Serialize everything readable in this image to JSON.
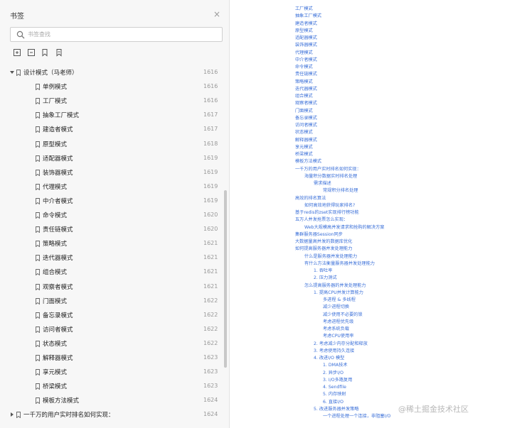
{
  "panel": {
    "title": "书签",
    "close_label": "×",
    "search_placeholder": "书签查找"
  },
  "toolbar": {
    "tools": [
      "expand-all-icon",
      "collapse-all-icon",
      "add-bookmark-icon",
      "remove-bookmark-icon"
    ]
  },
  "bookmarks": [
    {
      "label": "设计模式（马老师）",
      "page": "1616",
      "level": 0,
      "expanded": true
    },
    {
      "label": "单例模式",
      "page": "1616",
      "level": 1
    },
    {
      "label": "工厂模式",
      "page": "1616",
      "level": 1
    },
    {
      "label": "抽象工厂模式",
      "page": "1617",
      "level": 1
    },
    {
      "label": "建造者模式",
      "page": "1617",
      "level": 1
    },
    {
      "label": "原型模式",
      "page": "1618",
      "level": 1
    },
    {
      "label": "适配器模式",
      "page": "1619",
      "level": 1
    },
    {
      "label": "装饰器模式",
      "page": "1619",
      "level": 1
    },
    {
      "label": "代理模式",
      "page": "1619",
      "level": 1
    },
    {
      "label": "中介者模式",
      "page": "1619",
      "level": 1
    },
    {
      "label": "命令模式",
      "page": "1620",
      "level": 1
    },
    {
      "label": "责任链模式",
      "page": "1620",
      "level": 1
    },
    {
      "label": "策略模式",
      "page": "1621",
      "level": 1
    },
    {
      "label": "迭代器模式",
      "page": "1621",
      "level": 1
    },
    {
      "label": "组合模式",
      "page": "1621",
      "level": 1
    },
    {
      "label": "观察者模式",
      "page": "1621",
      "level": 1
    },
    {
      "label": "门面模式",
      "page": "1622",
      "level": 1
    },
    {
      "label": "备忘录模式",
      "page": "1622",
      "level": 1
    },
    {
      "label": "访问者模式",
      "page": "1622",
      "level": 1
    },
    {
      "label": "状态模式",
      "page": "1622",
      "level": 1
    },
    {
      "label": "解释器模式",
      "page": "1623",
      "level": 1
    },
    {
      "label": "享元模式",
      "page": "1623",
      "level": 1
    },
    {
      "label": "桥梁模式",
      "page": "1623",
      "level": 1
    },
    {
      "label": "模板方法模式",
      "page": "1624",
      "level": 1
    },
    {
      "label": "一千万的用户实时排名如何实现：",
      "page": "1624",
      "level": 0,
      "expanded": false
    }
  ],
  "toc": [
    {
      "text": "工厂模式",
      "indent": 0
    },
    {
      "text": "抽象工厂模式",
      "indent": 0
    },
    {
      "text": "建造者模式",
      "indent": 0
    },
    {
      "text": "原型模式",
      "indent": 0
    },
    {
      "text": "适配器模式",
      "indent": 0
    },
    {
      "text": "装饰器模式",
      "indent": 0
    },
    {
      "text": "代理模式",
      "indent": 0
    },
    {
      "text": "中介者模式",
      "indent": 0
    },
    {
      "text": "命令模式",
      "indent": 0
    },
    {
      "text": "责任链模式",
      "indent": 0
    },
    {
      "text": "策略模式",
      "indent": 0
    },
    {
      "text": "迭代器模式",
      "indent": 0
    },
    {
      "text": "组合模式",
      "indent": 0
    },
    {
      "text": "观察者模式",
      "indent": 0
    },
    {
      "text": "门面模式",
      "indent": 0
    },
    {
      "text": "备忘录模式",
      "indent": 0
    },
    {
      "text": "访问者模式",
      "indent": 0
    },
    {
      "text": "状态模式",
      "indent": 0
    },
    {
      "text": "解释器模式",
      "indent": 0
    },
    {
      "text": "享元模式",
      "indent": 0
    },
    {
      "text": "桥梁模式",
      "indent": 0
    },
    {
      "text": "模板方法模式",
      "indent": 0
    },
    {
      "text": "一千万的用户实时排名如何实现：",
      "indent": 0
    },
    {
      "text": "海量积分数据实时排名处理",
      "indent": 1
    },
    {
      "text": "需求描述",
      "indent": 2
    },
    {
      "text": "常规积分排名处理",
      "indent": 3
    },
    {
      "text": "高效的排名算法",
      "indent": 0
    },
    {
      "text": "如何高效地获得玩家排名?",
      "indent": 1
    },
    {
      "text": "基于redis的zset实现排行榜功能",
      "indent": 0
    },
    {
      "text": "五万人并发抢票怎么实现：",
      "indent": 0
    },
    {
      "text": "Web大规模高并发请求和抢购的解决方案",
      "indent": 1
    },
    {
      "text": "集群服务器Session同步",
      "indent": 0
    },
    {
      "text": "大数据量高并发的数据库优化",
      "indent": 0
    },
    {
      "text": "如何提高服务器并发处理能力",
      "indent": 0
    },
    {
      "text": "什么是服务器并发处理能力",
      "indent": 1
    },
    {
      "text": "有什么方法衡量服务器并发处理能力",
      "indent": 1
    },
    {
      "text": "1. 吞吐率",
      "indent": 2
    },
    {
      "text": "2. 压力测试",
      "indent": 2
    },
    {
      "text": "怎么提高服务器的并发处理能力",
      "indent": 1
    },
    {
      "text": "1. 提高CPU并发计算能力",
      "indent": 2
    },
    {
      "text": "多进程 & 多线程",
      "indent": 3
    },
    {
      "text": "减少进程切换",
      "indent": 3
    },
    {
      "text": "减少使用不必要的锁",
      "indent": 3
    },
    {
      "text": "考虑进程优先级",
      "indent": 3
    },
    {
      "text": "考虑系统负载",
      "indent": 3
    },
    {
      "text": "考虑CPU使用率",
      "indent": 3
    },
    {
      "text": "2. 考虑减少内存分配和释放",
      "indent": 2
    },
    {
      "text": "3. 考虑使用持久连接",
      "indent": 2
    },
    {
      "text": "4. 改进I/O 模型",
      "indent": 2
    },
    {
      "text": "1. DMA技术",
      "indent": 3
    },
    {
      "text": "2. 异步I/O",
      "indent": 3
    },
    {
      "text": "3. I/O多路复用",
      "indent": 3
    },
    {
      "text": "4. Sendfile",
      "indent": 3
    },
    {
      "text": "5. 内存映射",
      "indent": 3
    },
    {
      "text": "6. 直接I/O",
      "indent": 3
    },
    {
      "text": "5. 改进服务器并发策略",
      "indent": 2
    },
    {
      "text": "一个进程处理一个连接，非阻塞I/O",
      "indent": 3
    }
  ],
  "watermark": "@稀土掘金技术社区",
  "colors": {
    "toc_link": "#3a6fd8",
    "panel_bg": "#f7f7f7",
    "page_number": "#999999"
  }
}
